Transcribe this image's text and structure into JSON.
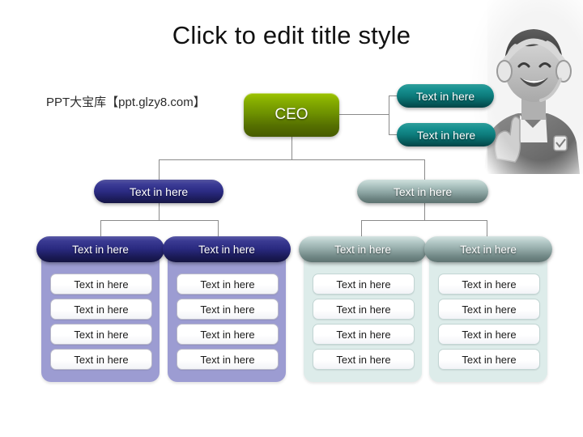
{
  "slide": {
    "title": "Click to edit title style",
    "watermark": "PPT大宝库【ppt.glzy8.com】",
    "background_color": "#ffffff"
  },
  "photo": {
    "name": "smiling-child-with-headphones-photo",
    "description": "grayscale photo of a smiling child wearing headphones giving a thumbs up"
  },
  "org_chart": {
    "root": {
      "label": "CEO",
      "color": "#6f9200"
    },
    "staff_nodes": [
      {
        "label": "Text in here",
        "color": "#0c7a7a"
      },
      {
        "label": "Text in here",
        "color": "#0c7a7a"
      }
    ],
    "branches": [
      {
        "label": "Text in here",
        "color": "#2b2b83",
        "groups": [
          {
            "header": "Text in here",
            "header_color": "#2a2a80",
            "panel_color": "#9c9cd2",
            "items": [
              "Text in here",
              "Text in here",
              "Text in here",
              "Text in here"
            ]
          },
          {
            "header": "Text in here",
            "header_color": "#2a2a80",
            "panel_color": "#9c9cd2",
            "items": [
              "Text in here",
              "Text in here",
              "Text in here",
              "Text in here"
            ]
          }
        ]
      },
      {
        "label": "Text in here",
        "color": "#93aaa8",
        "groups": [
          {
            "header": "Text in here",
            "header_color": "#93aaa8",
            "panel_color": "#ddecea",
            "items": [
              "Text in here",
              "Text in here",
              "Text in here",
              "Text in here"
            ]
          },
          {
            "header": "Text in here",
            "header_color": "#93aaa8",
            "panel_color": "#ddecea",
            "items": [
              "Text in here",
              "Text in here",
              "Text in here",
              "Text in here"
            ]
          }
        ]
      }
    ]
  }
}
